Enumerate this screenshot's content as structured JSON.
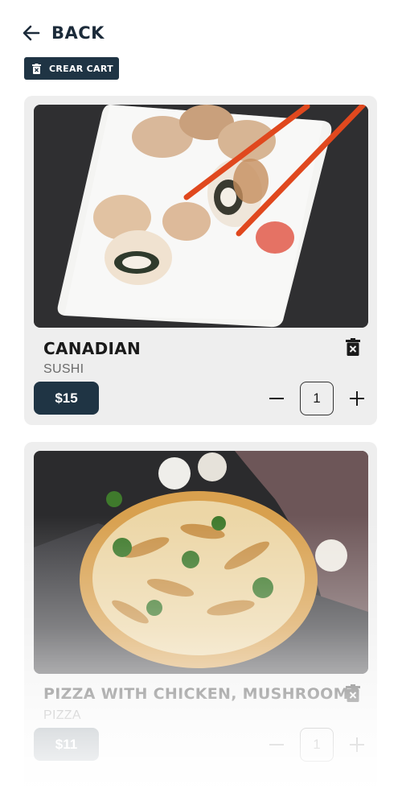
{
  "header": {
    "back_label": "BACK",
    "back_icon": "arrow-left-icon"
  },
  "toolbar": {
    "clear_cart_label": "CREAR CART",
    "clear_cart_icon": "trash-icon"
  },
  "cart": {
    "items": [
      {
        "name": "CANADIAN",
        "category": "SUSHI",
        "price": "$15",
        "quantity": "1",
        "image": "sushi-photo"
      },
      {
        "name": "PIZZA WITH CHICKEN, MUSHROOMS",
        "category": "PIZZA",
        "price": "$11",
        "quantity": "1",
        "image": "pizza-photo"
      }
    ]
  },
  "colors": {
    "primary": "#1f3444",
    "card_bg": "#eeeeee",
    "text_dark": "#1a1a1a",
    "text_muted": "#6b6b6b"
  }
}
